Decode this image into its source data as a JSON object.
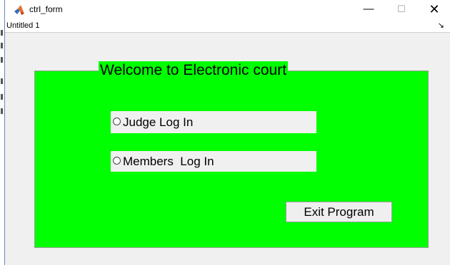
{
  "window": {
    "title": "ctrl_form",
    "minimize": "—",
    "maximize": "☐",
    "close": "✕"
  },
  "figure": {
    "name": "Untitled 1",
    "dock_arrow": "↘"
  },
  "panel": {
    "title": "Welcome to Electronic court",
    "background": "#00ff00"
  },
  "radios": [
    {
      "label": "Judge Log In",
      "selected": false
    },
    {
      "label": "Members  Log In",
      "selected": false
    }
  ],
  "buttons": {
    "exit_label": "Exit Program"
  },
  "icons": {
    "app": "matlab-icon"
  }
}
